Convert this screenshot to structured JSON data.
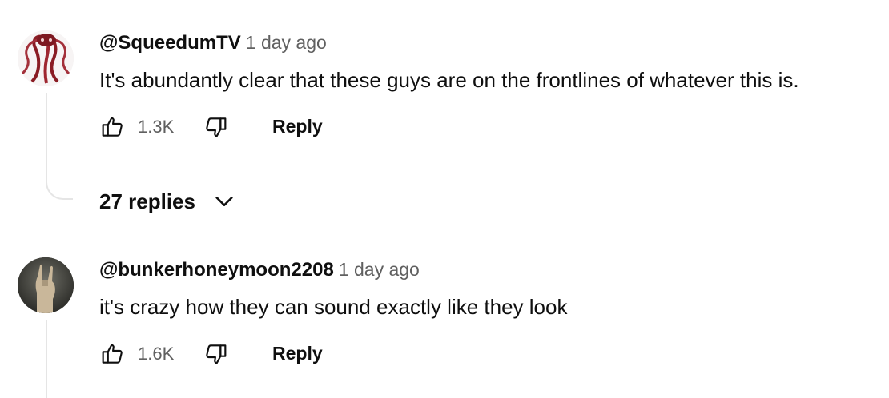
{
  "comments": [
    {
      "author": "@SqueedumTV",
      "time": "1 day ago",
      "text": "It's abundantly clear that these guys are on the frontlines of whatever this is.",
      "likes": "1.3K",
      "reply_label": "Reply",
      "replies_label": "27 replies"
    },
    {
      "author": "@bunkerhoneymoon2208",
      "time": "1 day ago",
      "text": "it's crazy how they can sound exactly like they look",
      "likes": "1.6K",
      "reply_label": "Reply"
    }
  ],
  "icons": {
    "like": "thumbs-up-icon",
    "dislike": "thumbs-down-icon",
    "expand": "chevron-down-icon"
  },
  "colors": {
    "primary_text": "#0f0f0f",
    "secondary_text": "#606060",
    "thread_line": "#e5e5e5"
  }
}
